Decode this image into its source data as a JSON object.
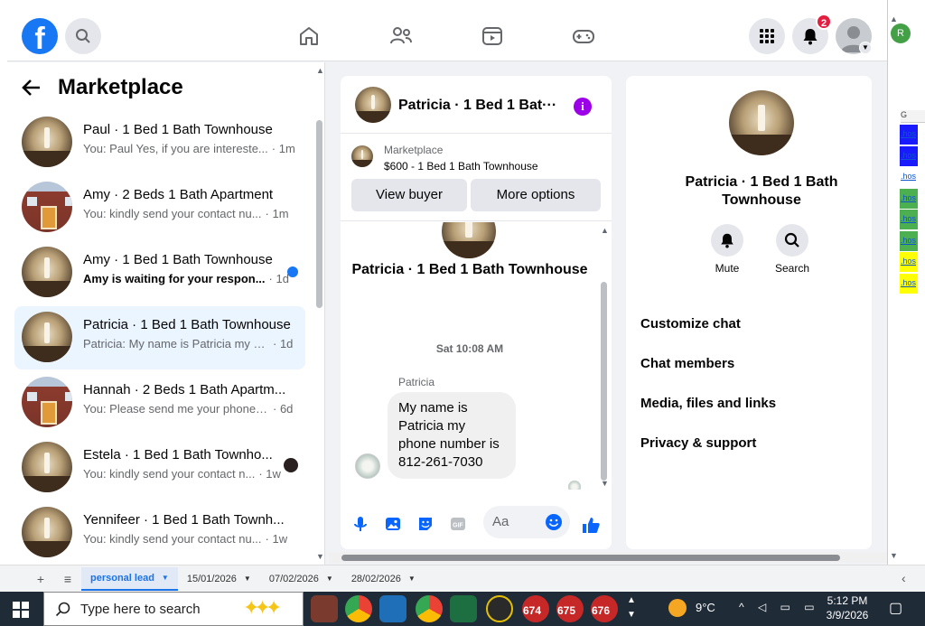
{
  "spreadsheet": {
    "col_header": "G",
    "cell_text": ".hos",
    "cell_colors": [
      "#1a1aff",
      "#1a1aff",
      "#ffffff",
      "#4caf50",
      "#4caf50",
      "#4caf50",
      "#ffff00",
      "#ffff00"
    ],
    "tabs": [
      {
        "label": "personal lead",
        "active": true
      },
      {
        "label": "15/01/2026",
        "active": false
      },
      {
        "label": "07/02/2026",
        "active": false
      },
      {
        "label": "28/02/2026",
        "active": false
      }
    ],
    "add_label": "+",
    "menu_label": "≡",
    "avatar_initial": "R"
  },
  "facebook": {
    "logo_letter": "f",
    "nav": [
      "home-icon",
      "friends-icon",
      "watch-icon",
      "gaming-icon"
    ],
    "notification_count": "2"
  },
  "marketplace": {
    "title": "Marketplace",
    "conversations": [
      {
        "title": "Paul · 1 Bed 1 Bath Townhouse",
        "preview": "You: Paul Yes, if you are intereste...",
        "time": "· 1m",
        "photo": "room",
        "unread": false
      },
      {
        "title": "Amy · 2 Beds 1 Bath Apartment",
        "preview": "You: kindly send your contact nu...",
        "time": "· 1m",
        "photo": "apt",
        "unread": false
      },
      {
        "title": "Amy · 1 Bed 1 Bath Townhouse",
        "preview": "Amy is waiting for your respon...",
        "time": "· 1d",
        "photo": "room",
        "unread": true
      },
      {
        "title": "Patricia · 1 Bed 1 Bath Townhouse",
        "preview": "Patricia: My name is Patricia my p...",
        "time": "· 1d",
        "photo": "room",
        "unread": false,
        "selected": true
      },
      {
        "title": "Hannah · 2 Beds 1 Bath Apartm...",
        "preview": "You: Please send me your phone n...",
        "time": "· 6d",
        "photo": "apt",
        "unread": false
      },
      {
        "title": "Estela · 1 Bed 1 Bath Townho...",
        "preview": "You: kindly send your contact n...",
        "time": "· 1w",
        "photo": "room",
        "unread": false,
        "mini_avatar": true
      },
      {
        "title": "Yennifeer · 1 Bed 1 Bath Townh...",
        "preview": "You: kindly send your contact nu...",
        "time": "· 1w",
        "photo": "room",
        "unread": false
      }
    ]
  },
  "chat": {
    "header_name": "Patricia · 1 Bed 1 Bat···",
    "info_icon": "i",
    "listing_source": "Marketplace",
    "listing_title": "$600 - 1 Bed 1 Bath Townhouse",
    "view_buyer": "View buyer",
    "more_options": "More options",
    "body_name": "Patricia · 1 Bed 1 Bath Townhouse",
    "timestamp": "Sat 10:08 AM",
    "sender": "Patricia",
    "message": "My name is Patricia my phone number is 812-261-7030",
    "composer_placeholder": "Aa"
  },
  "info_panel": {
    "title": "Patricia · 1 Bed 1 Bath Townhouse",
    "actions": [
      {
        "label": "Mute",
        "icon": "bell-icon"
      },
      {
        "label": "Search",
        "icon": "search-icon"
      }
    ],
    "menu": [
      "Customize chat",
      "Chat members",
      "Media, files and links",
      "Privacy & support"
    ]
  },
  "taskbar": {
    "search_placeholder": "Type here to search",
    "badges": [
      "674",
      "675",
      "676"
    ],
    "temperature": "9°C",
    "time": "5:12 PM",
    "date": "3/9/2026"
  }
}
